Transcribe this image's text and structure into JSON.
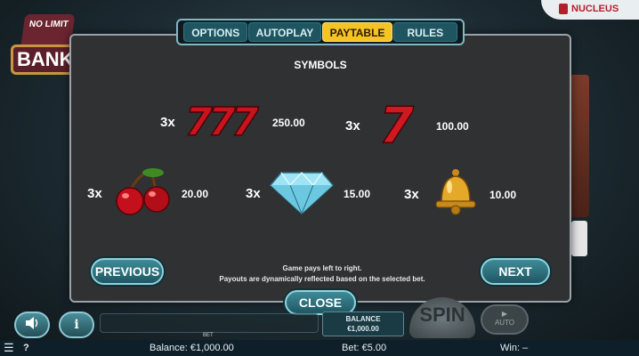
{
  "game": {
    "logo_top": "NO LIMIT",
    "logo_bottom": "BANK",
    "brand": "NUCLEUS"
  },
  "tabs": [
    {
      "label": "OPTIONS",
      "active": false
    },
    {
      "label": "AUTOPLAY",
      "active": false
    },
    {
      "label": "PAYTABLE",
      "active": true
    },
    {
      "label": "RULES",
      "active": false
    }
  ],
  "paytable": {
    "heading": "SYMBOLS",
    "items": [
      {
        "symbol": "triple-seven-icon",
        "multiplier": "3x",
        "payout": "250.00"
      },
      {
        "symbol": "seven-icon",
        "multiplier": "3x",
        "payout": "100.00"
      },
      {
        "symbol": "cherries-icon",
        "multiplier": "3x",
        "payout": "20.00"
      },
      {
        "symbol": "diamond-icon",
        "multiplier": "3x",
        "payout": "15.00"
      },
      {
        "symbol": "bell-icon",
        "multiplier": "3x",
        "payout": "10.00"
      }
    ],
    "note_line1": "Game pays left to right.",
    "note_line2": "Payouts are dynamically reflected based on the selected bet.",
    "previous_label": "PREVIOUS",
    "next_label": "NEXT",
    "close_label": "CLOSE"
  },
  "controls": {
    "sound_icon": "speaker-icon",
    "info_label": "i",
    "bet_label": "BET",
    "balance_label": "BALANCE",
    "balance_value": "€1,000.00",
    "spin_label": "SPIN",
    "auto_label": "AUTO"
  },
  "status_bar": {
    "balance": "Balance: €1,000.00",
    "bet": "Bet: €5.00",
    "win": "Win: –",
    "help_label": "?"
  },
  "colors": {
    "accent_tab": "#f4c425",
    "button_teal": "#2a6f7c",
    "panel": "#2f3133"
  }
}
